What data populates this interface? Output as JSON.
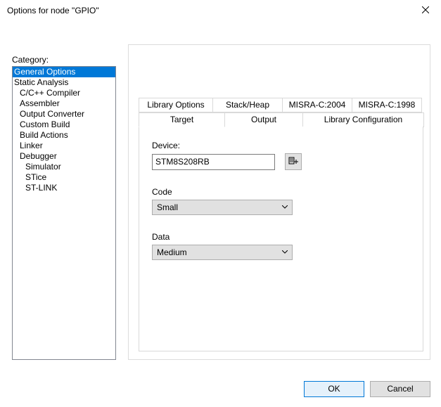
{
  "window": {
    "title": "Options for node \"GPIO\""
  },
  "category": {
    "label": "Category:",
    "items": [
      {
        "label": "General Options",
        "indent": 0,
        "selected": true
      },
      {
        "label": "Static Analysis",
        "indent": 0,
        "selected": false
      },
      {
        "label": "C/C++ Compiler",
        "indent": 1,
        "selected": false
      },
      {
        "label": "Assembler",
        "indent": 1,
        "selected": false
      },
      {
        "label": "Output Converter",
        "indent": 1,
        "selected": false
      },
      {
        "label": "Custom Build",
        "indent": 1,
        "selected": false
      },
      {
        "label": "Build Actions",
        "indent": 1,
        "selected": false
      },
      {
        "label": "Linker",
        "indent": 1,
        "selected": false
      },
      {
        "label": "Debugger",
        "indent": 1,
        "selected": false
      },
      {
        "label": "Simulator",
        "indent": 2,
        "selected": false
      },
      {
        "label": "STice",
        "indent": 2,
        "selected": false
      },
      {
        "label": "ST-LINK",
        "indent": 2,
        "selected": false
      }
    ]
  },
  "tabs": {
    "row1": [
      "Library Options",
      "Stack/Heap",
      "MISRA-C:2004",
      "MISRA-C:1998"
    ],
    "row2": [
      "Target",
      "Output",
      "Library Configuration"
    ],
    "active": "Target"
  },
  "target_tab": {
    "device_label": "Device:",
    "device_value": "STM8S208RB",
    "code_label": "Code",
    "code_value": "Small",
    "data_label": "Data",
    "data_value": "Medium"
  },
  "buttons": {
    "ok": "OK",
    "cancel": "Cancel"
  }
}
